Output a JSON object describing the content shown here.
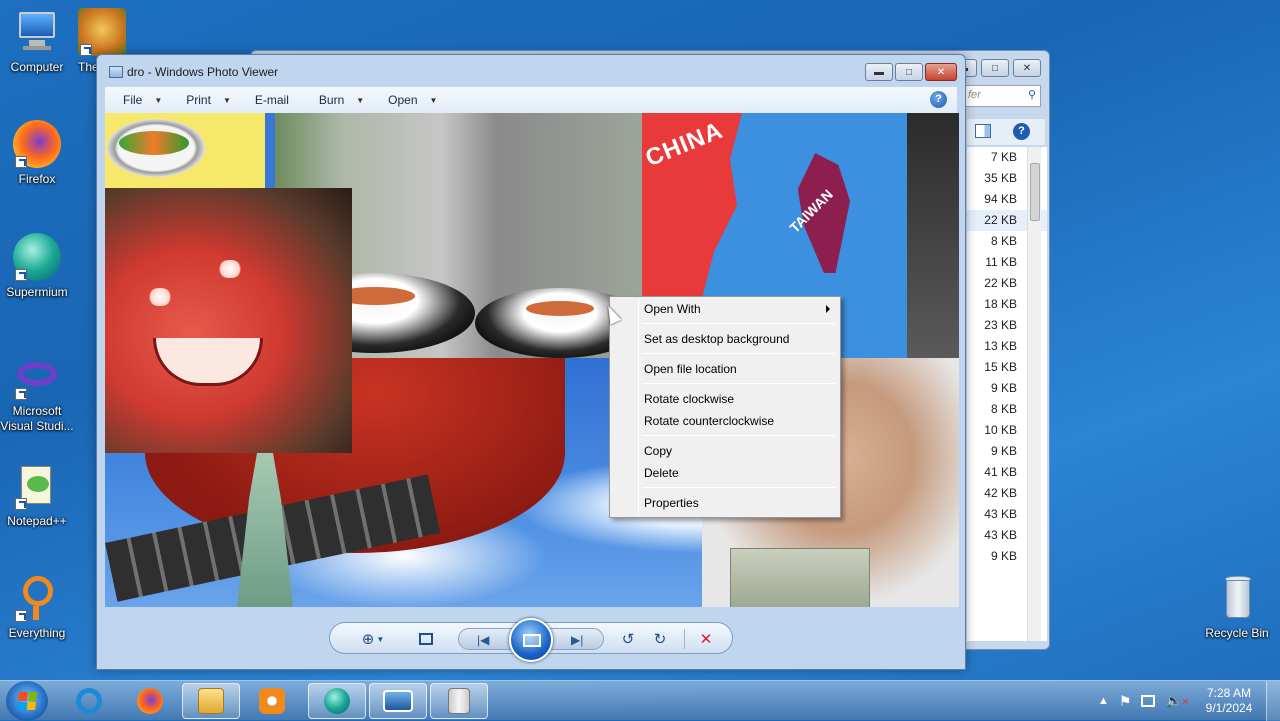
{
  "desktop": {
    "icons": [
      {
        "label": "Computer"
      },
      {
        "label": "The"
      },
      {
        "label": "Firefox"
      },
      {
        "label": "Supermium"
      },
      {
        "label": "Microsoft Visual Studi..."
      },
      {
        "label": "Notepad++"
      },
      {
        "label": "Everything"
      },
      {
        "label": "Recycle Bin"
      }
    ]
  },
  "explorer": {
    "search_placeholder": "fer",
    "sizes": [
      "7 KB",
      "35 KB",
      "94 KB",
      "22 KB",
      "8 KB",
      "11 KB",
      "22 KB",
      "18 KB",
      "23 KB",
      "13 KB",
      "15 KB",
      "9 KB",
      "8 KB",
      "10 KB",
      "9 KB",
      "41 KB",
      "42 KB",
      "43 KB",
      "43 KB",
      "9 KB"
    ],
    "selected_index": 3
  },
  "viewer": {
    "title": "dro - Windows Photo Viewer",
    "menu": [
      {
        "label": "File",
        "caret": "▼"
      },
      {
        "label": "Print",
        "caret": "▼"
      },
      {
        "label": "E-mail",
        "caret": ""
      },
      {
        "label": "Burn",
        "caret": "▼"
      },
      {
        "label": "Open",
        "caret": "▼"
      }
    ],
    "help": "?",
    "photo_text": {
      "china": "CHINA",
      "taiwan": "TAIWAN"
    }
  },
  "context_menu": {
    "items": [
      "Open With",
      "Set as desktop background",
      "Open file location",
      "Rotate clockwise",
      "Rotate counterclockwise",
      "Copy",
      "Delete",
      "Properties"
    ]
  },
  "taskbar": {
    "time": "7:28 AM",
    "date": "9/1/2024"
  },
  "colors": {
    "accent": "#1f5bb0",
    "close_red": "#c74230",
    "desktop_blue": "#1966b4"
  }
}
